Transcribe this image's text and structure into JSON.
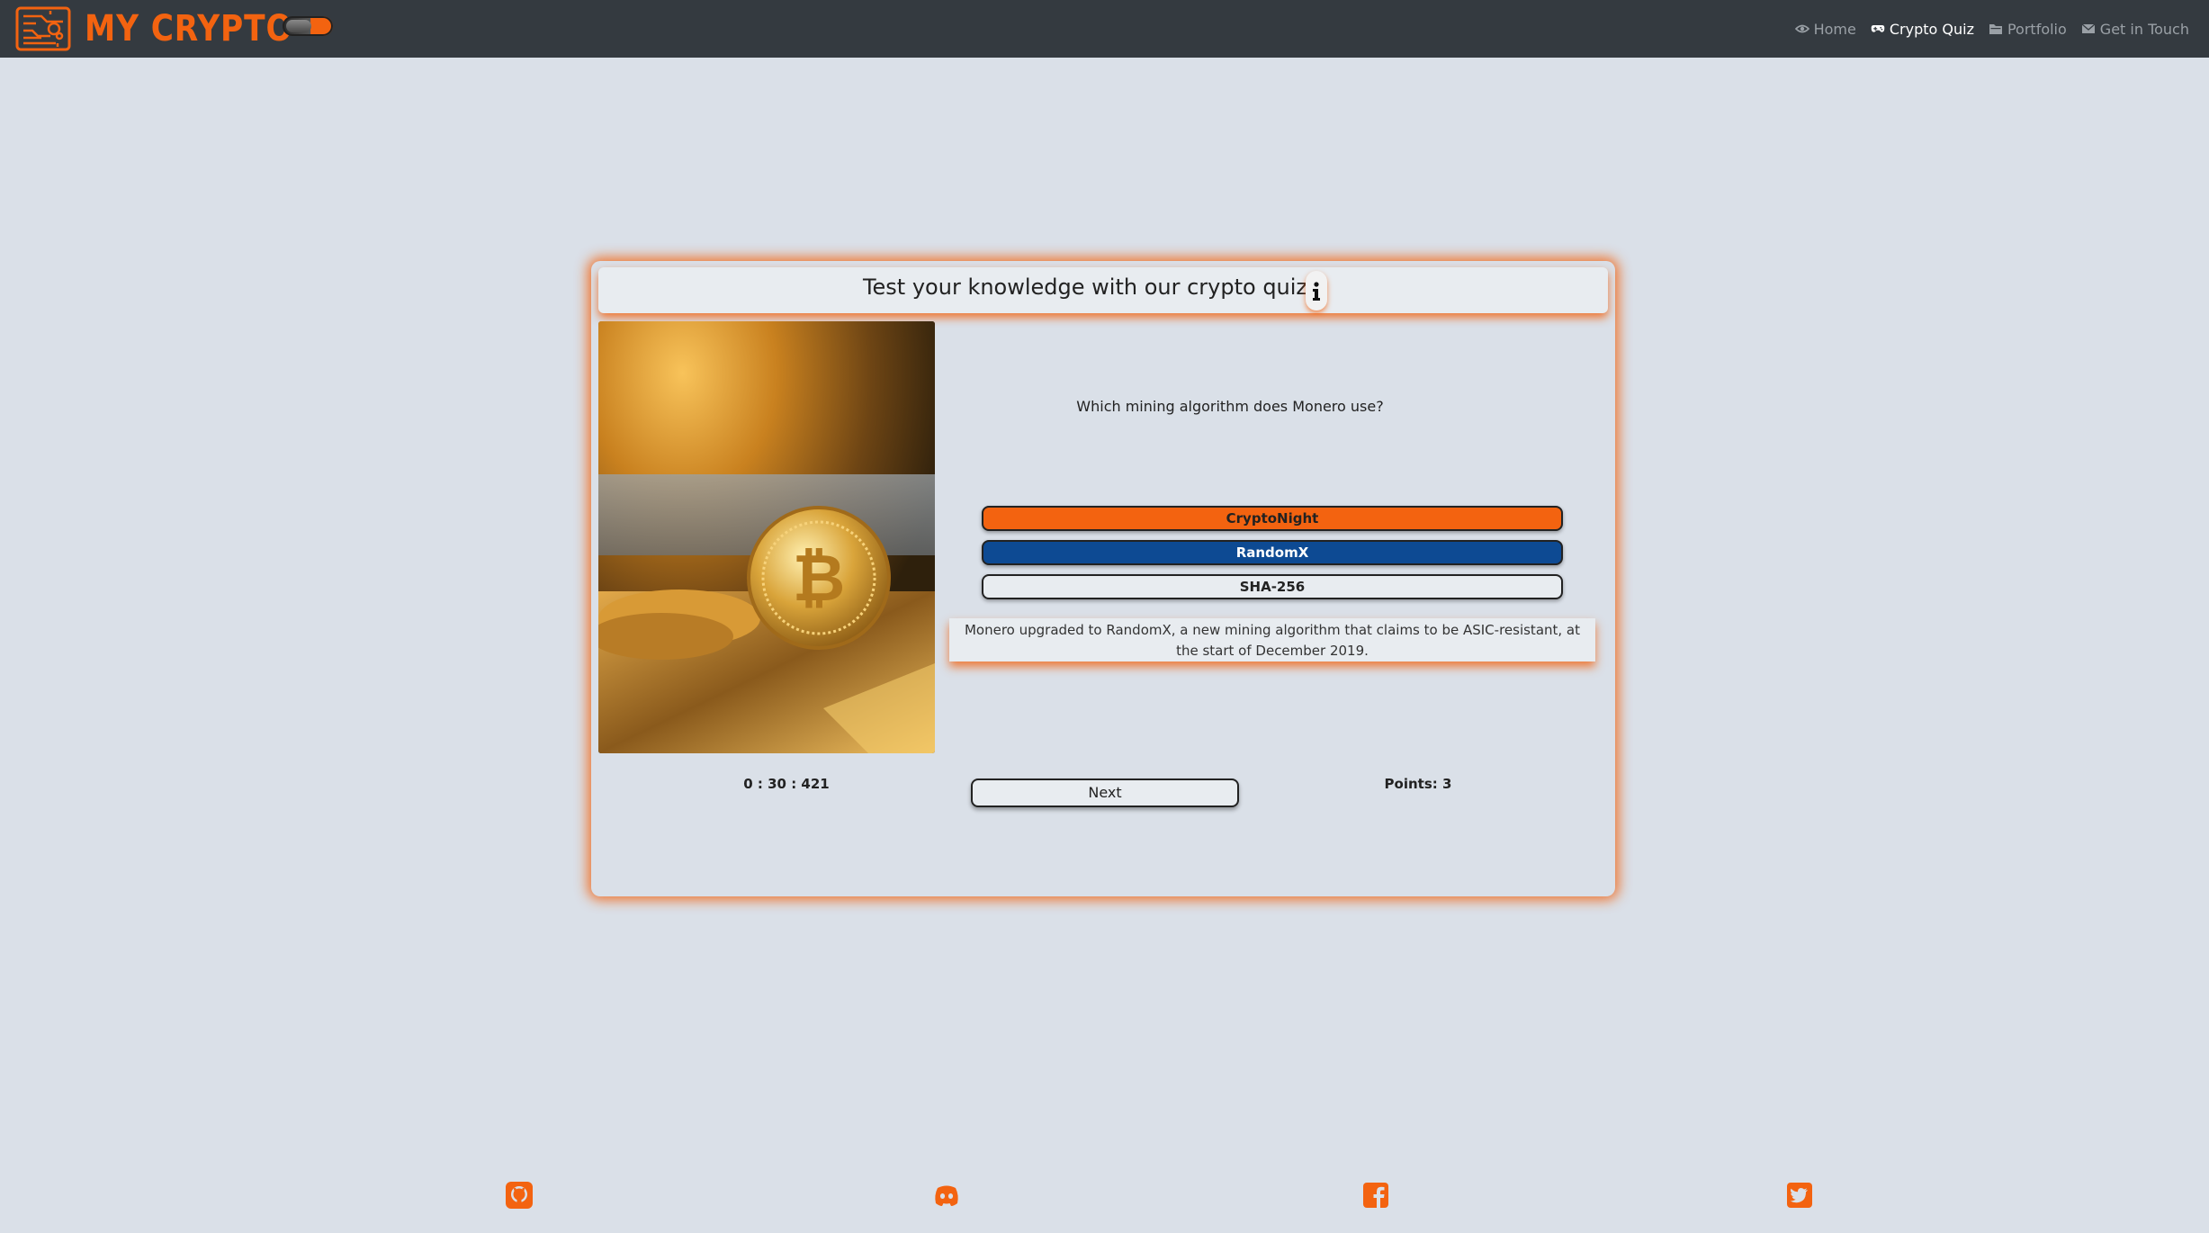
{
  "brand": {
    "name": "MY CRYPTO"
  },
  "nav": {
    "items": [
      {
        "label": "Home",
        "icon": "eye-icon",
        "active": false
      },
      {
        "label": "Crypto Quiz",
        "icon": "gamepad-icon",
        "active": true
      },
      {
        "label": "Portfolio",
        "icon": "folder-icon",
        "active": false
      },
      {
        "label": "Get in Touch",
        "icon": "envelope-icon",
        "active": false
      }
    ]
  },
  "quiz": {
    "title": "Test your knowledge with our crypto quiz",
    "question": "Which mining algorithm does Monero use?",
    "answers": [
      {
        "label": "CryptoNight",
        "state": "selected-wrong"
      },
      {
        "label": "RandomX",
        "state": "correct"
      },
      {
        "label": "SHA-256",
        "state": "neutral"
      }
    ],
    "explanation": "Monero upgraded to RandomX, a new mining algorithm that claims to be ASIC-resistant, at the start of December 2019.",
    "timer": "0 : 30 : 421",
    "next_label": "Next",
    "points": "Points: 3"
  },
  "footer": {
    "social": [
      "github-icon",
      "discord-icon",
      "facebook-icon",
      "twitter-icon"
    ]
  },
  "colors": {
    "accent": "#f36310",
    "navbar": "#343a40",
    "background": "#dae0e8",
    "correct": "#0d4a93"
  }
}
